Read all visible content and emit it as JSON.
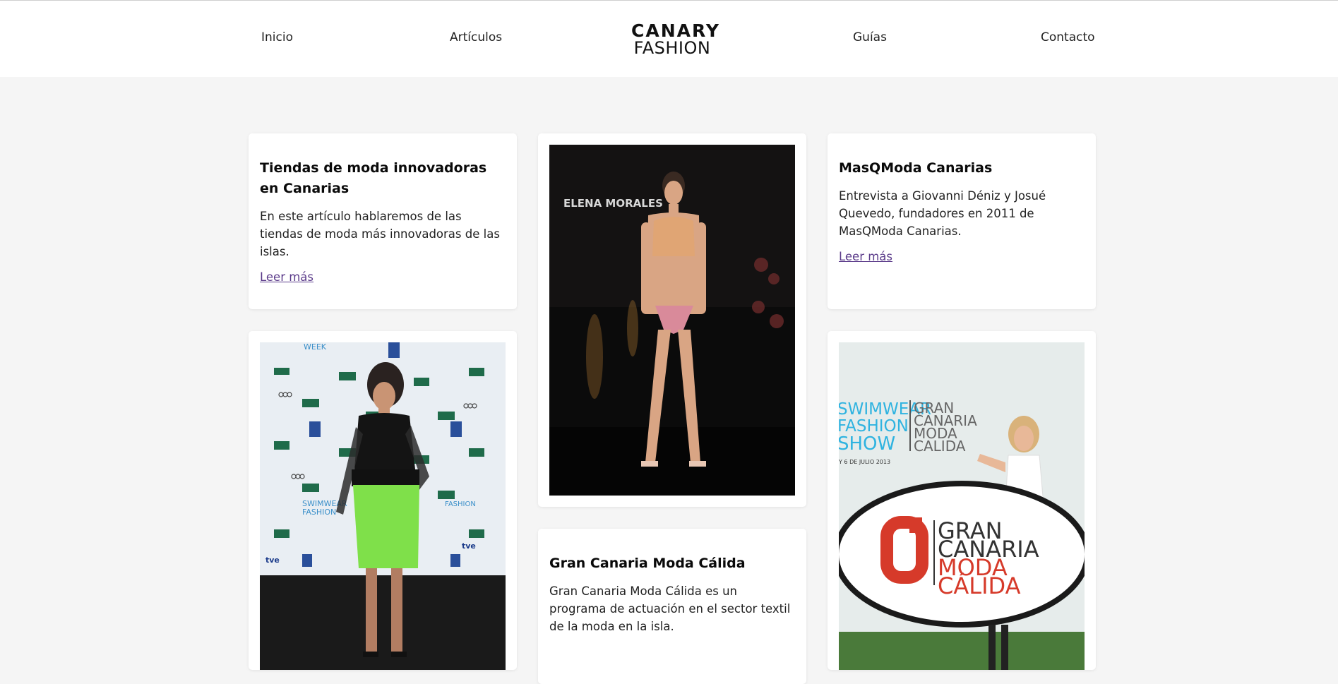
{
  "nav": {
    "items": [
      "Inicio",
      "Artículos",
      "Guías",
      "Contacto"
    ],
    "logo_top": "CANARY",
    "logo_bottom": "FASHION"
  },
  "cards": [
    {
      "title": "Tiendas de moda innovadoras en Canarias",
      "text": "En este artículo hablaremos de las tiendas de moda más innovadoras de las islas.",
      "link": "Leer más"
    },
    {
      "title": "MasQModa Canarias",
      "text": "Entrevista a Giovanni Déniz y Josué Quevedo, fundadores en 2011 de MasQModa Canarias.",
      "link": "Leer más"
    },
    {
      "title": "Gran Canaria Moda Cálida",
      "text": "Gran Canaria Moda Cálida es un programa de actuación en el sector textil de la moda en la isla."
    }
  ],
  "images": {
    "runway_sign": "ELENA MORALES",
    "event_banner_lines": [
      "SWIMWEAR",
      "FASHION",
      "SHOW"
    ],
    "event_banner_right": [
      "GRAN",
      "CANARIA",
      "MODA",
      "CALIDA"
    ],
    "event_date": "Y 6 DE JULIO 2013",
    "standee_lines": [
      "GRAN",
      "CANARIA",
      "MODA",
      "CÁLIDA"
    ],
    "photocall_words": [
      "SWIMWEAR",
      "FASHION",
      "WEEK",
      "tve",
      "Audi"
    ]
  },
  "colors": {
    "page_bg": "#f5f5f5",
    "card_bg": "#ffffff",
    "link": "#5b3b8a",
    "brand_red": "#d63a2a",
    "skirt_green": "#7fe04a"
  }
}
